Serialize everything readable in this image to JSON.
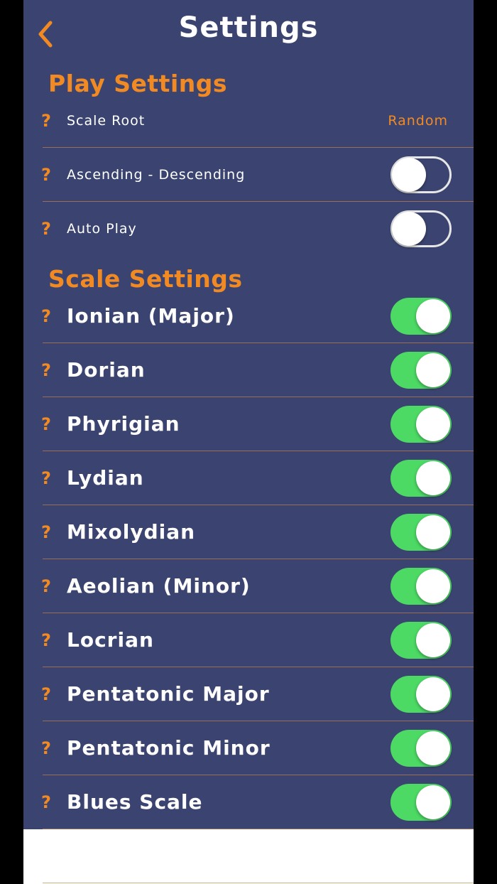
{
  "header": {
    "title": "Settings",
    "back_icon": "chevron-left-icon"
  },
  "colors": {
    "panel": "#3b4470",
    "accent": "#f28a23",
    "toggle_on": "#4cd964",
    "text": "#ffffff"
  },
  "play_settings": {
    "heading": "Play Settings",
    "help_glyph": "?",
    "scale_root": {
      "label": "Scale Root",
      "value": "Random"
    },
    "ascending_descending": {
      "label": "Ascending - Descending",
      "on": false
    },
    "auto_play": {
      "label": "Auto Play",
      "on": false
    }
  },
  "scale_settings": {
    "heading": "Scale Settings",
    "items": [
      {
        "label": "Ionian (Major)",
        "on": true
      },
      {
        "label": "Dorian",
        "on": true
      },
      {
        "label": "Phyrigian",
        "on": true
      },
      {
        "label": "Lydian",
        "on": true
      },
      {
        "label": "Mixolydian",
        "on": true
      },
      {
        "label": "Aeolian (Minor)",
        "on": true
      },
      {
        "label": "Locrian",
        "on": true
      },
      {
        "label": "Pentatonic Major",
        "on": true
      },
      {
        "label": "Pentatonic Minor",
        "on": true
      },
      {
        "label": "Blues Scale",
        "on": true
      }
    ]
  }
}
